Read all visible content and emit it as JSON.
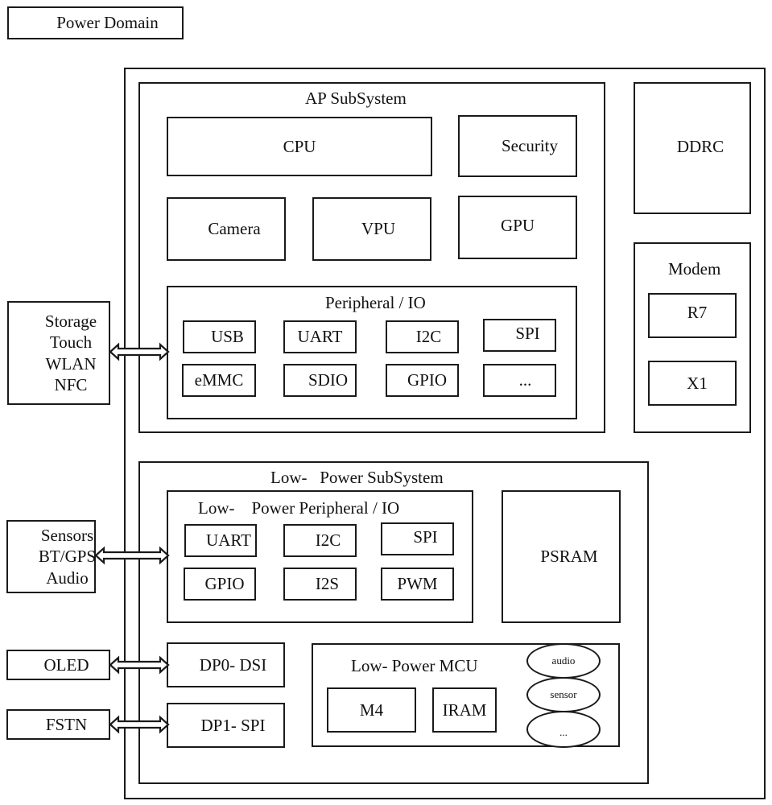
{
  "legend": {
    "label": "Power Domain"
  },
  "ap_subsystem": {
    "title": "AP SubSystem",
    "blocks": {
      "cpu": "CPU",
      "security": "Security",
      "camera": "Camera",
      "vpu": "VPU",
      "gpu": "GPU"
    },
    "peripheral_io": {
      "title": "Peripheral / IO",
      "items": [
        "USB",
        "UART",
        "I2C",
        "SPI",
        "eMMC",
        "SDIO",
        "GPIO",
        "..."
      ]
    }
  },
  "ddrc": {
    "label": "DDRC"
  },
  "modem": {
    "title": "Modem",
    "items": [
      "R7",
      "X1"
    ]
  },
  "low_power_subsystem": {
    "title": "Low-   Power SubSystem",
    "peripheral_io": {
      "title": "Low-    Power Peripheral / IO",
      "items": [
        "UART",
        "I2C",
        "SPI",
        "GPIO",
        "I2S",
        "PWM"
      ]
    },
    "psram": "PSRAM",
    "dp0": "DP0- DSI",
    "dp1": "DP1- SPI",
    "mcu": {
      "title": "Low- Power MCU",
      "m4": "M4",
      "iram": "IRAM",
      "ellipses": [
        "audio",
        "sensor",
        "..."
      ]
    }
  },
  "external": {
    "storage_group": [
      "Storage",
      "Touch",
      "WLAN",
      "NFC"
    ],
    "sensor_group": [
      "Sensors",
      "BT/GPS",
      "Audio"
    ],
    "oled": "OLED",
    "fstn": "FSTN"
  },
  "connections": [
    {
      "from": "storage_group",
      "to": "ap_peripheral_io",
      "type": "bidirectional"
    },
    {
      "from": "sensor_group",
      "to": "lp_peripheral_io",
      "type": "bidirectional"
    },
    {
      "from": "oled",
      "to": "dp0",
      "type": "bidirectional"
    },
    {
      "from": "fstn",
      "to": "dp1",
      "type": "bidirectional"
    }
  ]
}
